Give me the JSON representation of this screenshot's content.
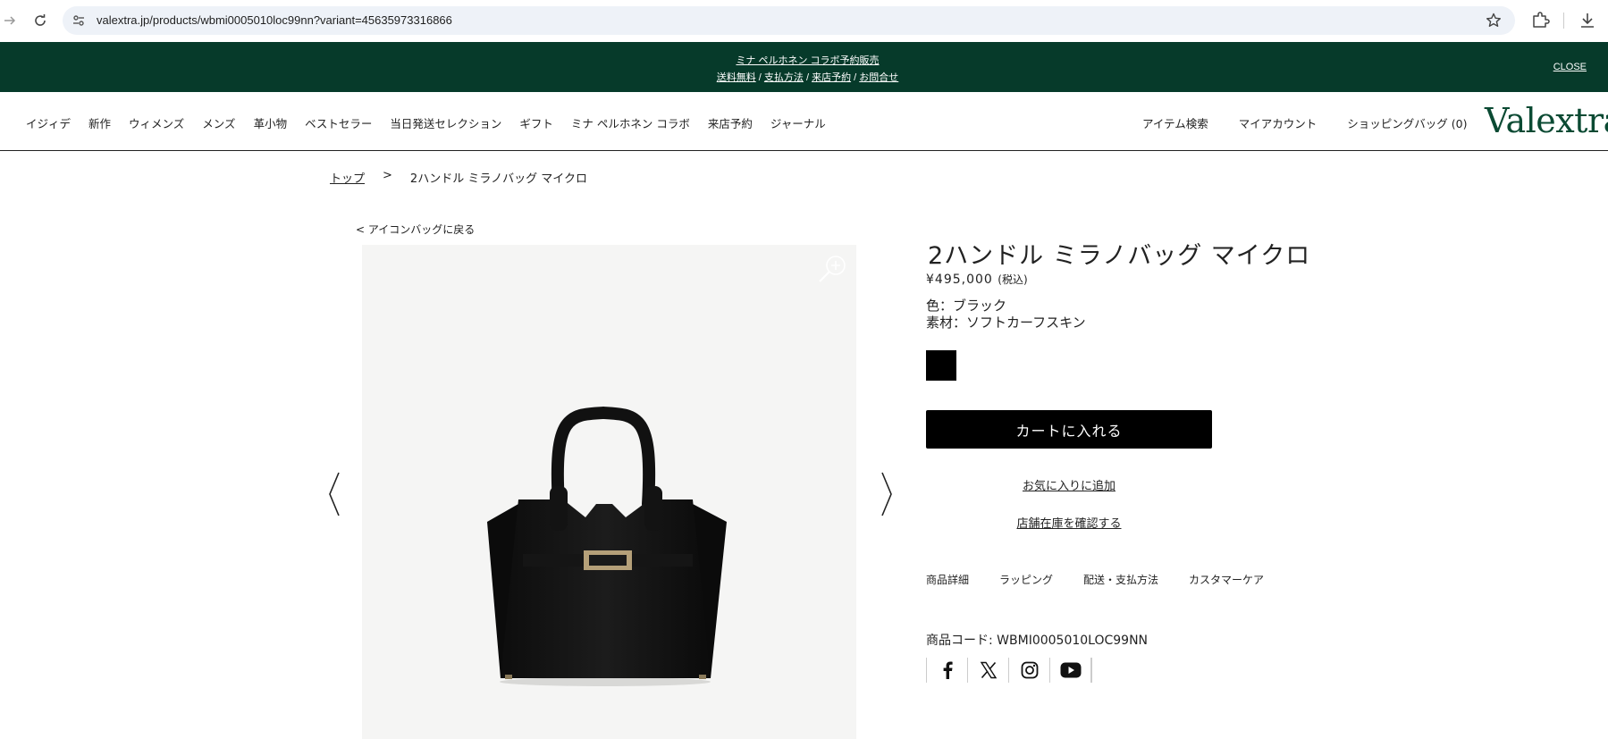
{
  "browser": {
    "url": "valextra.jp/products/wbmi0005010loc99nn?variant=45635973316866"
  },
  "announcement": {
    "line1": "ミナ ペルホネン コラボ予約販売",
    "links": [
      "送料無料",
      "支払方法",
      "来店予約",
      "お問合せ"
    ],
    "separator": " / ",
    "close": "CLOSE"
  },
  "nav": {
    "items": [
      "イジィデ",
      "新作",
      "ウィメンズ",
      "メンズ",
      "革小物",
      "ベストセラー",
      "当日発送セレクション",
      "ギフト",
      "ミナ ペルホネン コラボ",
      "来店予約",
      "ジャーナル"
    ],
    "right": [
      "アイテム検索",
      "マイアカウント",
      "ショッピングバッグ (0)"
    ],
    "logo": "Valextra"
  },
  "breadcrumb": {
    "home": "トップ",
    "separator": ">",
    "current": "2ハンドル ミラノバッグ マイクロ"
  },
  "back_link": "< アイコンバッグに戻る",
  "product": {
    "title": "2ハンドル ミラノバッグ マイクロ",
    "price": "¥495,000",
    "tax": "(税込)",
    "color": "色：ブラック",
    "material": "素材：ソフトカーフスキン",
    "swatch_color": "#000000",
    "add_to_cart": "カートに入れる",
    "favorite": "お気に入りに追加",
    "store_stock": "店舗在庫を確認する",
    "tabs": [
      "商品詳細",
      "ラッピング",
      "配送・支払方法",
      "カスタマーケア"
    ],
    "code": "商品コード: WBMI0005010LOC99NN"
  },
  "social": [
    "facebook-icon",
    "x-icon",
    "instagram-icon",
    "youtube-icon"
  ]
}
